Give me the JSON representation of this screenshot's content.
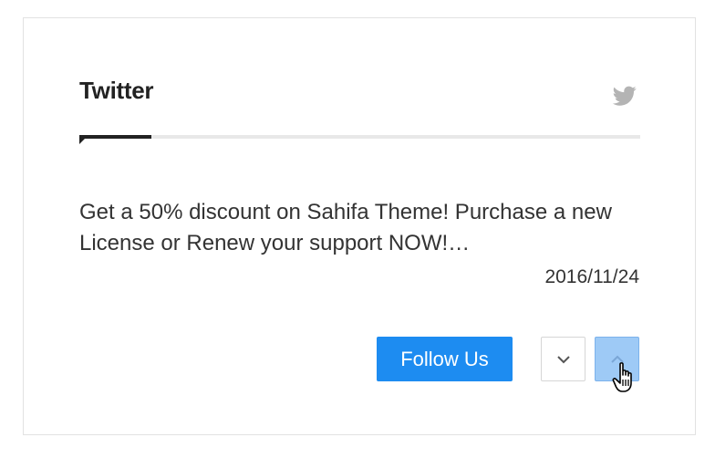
{
  "widget": {
    "title": "Twitter",
    "title_icon": "twitter-bird-icon"
  },
  "tweet": {
    "text": "Get a 50% discount on Sahifa Theme! Purchase a new License or Renew your support NOW!…",
    "date": "2016/11/24"
  },
  "actions": {
    "follow_label": "Follow Us",
    "prev_icon": "chevron-down-icon",
    "next_icon": "chevron-up-icon"
  },
  "pointer": "hand-cursor-icon",
  "colors": {
    "accent": "#1d8cf1",
    "icon_gray": "#b4b4b4",
    "text": "#333333",
    "heading": "#222222",
    "border": "#e2e2e2",
    "active_nav": "#9ecaf6"
  }
}
